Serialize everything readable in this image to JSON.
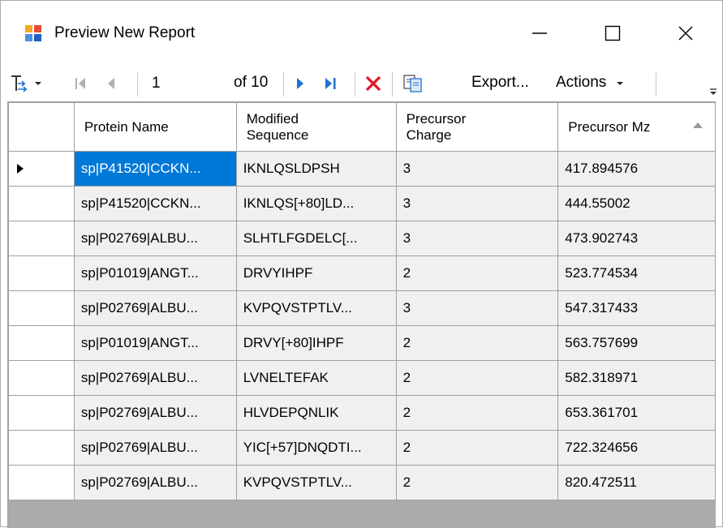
{
  "window": {
    "title": "Preview New Report"
  },
  "toolbar": {
    "current_page": "1",
    "of_pages": "of 10",
    "export_label": "Export...",
    "actions_label": "Actions"
  },
  "grid": {
    "columns": [
      "Protein Name",
      "Modified\nSequence",
      "Precursor\nCharge",
      "Precursor Mz"
    ],
    "rows": [
      [
        "sp|P41520|CCKN...",
        "IKNLQSLDPSH",
        "3",
        "417.894576"
      ],
      [
        "sp|P41520|CCKN...",
        "IKNLQS[+80]LD...",
        "3",
        "444.55002"
      ],
      [
        "sp|P02769|ALBU...",
        "SLHTLFGDELC[...",
        "3",
        "473.902743"
      ],
      [
        "sp|P01019|ANGT...",
        "DRVYIHPF",
        "2",
        "523.774534"
      ],
      [
        "sp|P02769|ALBU...",
        "KVPQVSTPTLV...",
        "3",
        "547.317433"
      ],
      [
        "sp|P01019|ANGT...",
        "DRVY[+80]IHPF",
        "2",
        "563.757699"
      ],
      [
        "sp|P02769|ALBU...",
        "LVNELTEFAK",
        "2",
        "582.318971"
      ],
      [
        "sp|P02769|ALBU...",
        "HLVDEPQNLIK",
        "2",
        "653.361701"
      ],
      [
        "sp|P02769|ALBU...",
        "YIC[+57]DNQDTI...",
        "2",
        "722.324656"
      ],
      [
        "sp|P02769|ALBU...",
        "KVPQVSTPTLV...",
        "2",
        "820.472511"
      ]
    ],
    "selected_row": 0,
    "sorted_column": "Precursor Mz"
  },
  "colors": {
    "selection": "#0078d7",
    "cell_background": "#f0f0f0",
    "grid_line": "#a0a0a0",
    "nav_arrow": "#1e73d2",
    "delete_x": "#e81123"
  },
  "icons": [
    "report-app-icon",
    "minimize-icon",
    "maximize-icon",
    "close-icon",
    "document-map-icon",
    "first-page-icon",
    "previous-page-icon",
    "next-page-icon",
    "last-page-icon",
    "stop-icon",
    "copy-icon",
    "dropdown-arrow-icon",
    "sort-ascending-icon",
    "current-row-icon"
  ]
}
